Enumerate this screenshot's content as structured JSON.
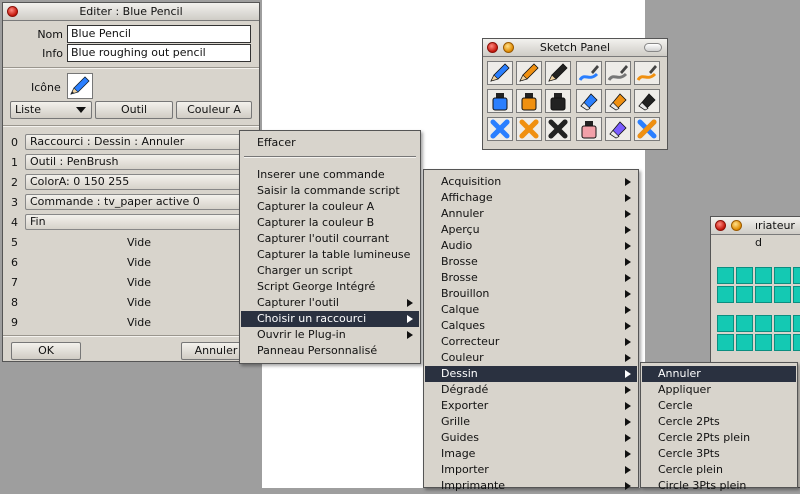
{
  "editor": {
    "title": "Editer : Blue Pencil",
    "nom_label": "Nom",
    "nom_value": "Blue Pencil",
    "info_label": "Info",
    "info_value": "Blue roughing out pencil",
    "icone_label": "Icône",
    "liste_label": "Liste",
    "outil_label": "Outil",
    "couleur_label": "Couleur A",
    "slots": [
      {
        "index": "0",
        "text": "Raccourci : Dessin : Annuler"
      },
      {
        "index": "1",
        "text": "Outil : PenBrush"
      },
      {
        "index": "2",
        "text": "ColorA: 0 150 255"
      },
      {
        "index": "3",
        "text": "Commande : tv_paper active 0"
      },
      {
        "index": "4",
        "text": "Fin"
      },
      {
        "index": "5",
        "text": "Vide"
      },
      {
        "index": "6",
        "text": "Vide"
      },
      {
        "index": "7",
        "text": "Vide"
      },
      {
        "index": "8",
        "text": "Vide"
      },
      {
        "index": "9",
        "text": "Vide"
      }
    ],
    "ok_label": "OK",
    "annuler_label": "Annuler"
  },
  "context_menu": {
    "items": [
      {
        "label": "Effacer"
      },
      {
        "label": "Inserer une commande"
      },
      {
        "label": "Saisir la commande script"
      },
      {
        "label": "Capturer la couleur A"
      },
      {
        "label": "Capturer la couleur B"
      },
      {
        "label": "Capturer l'outil courrant"
      },
      {
        "label": "Capturer la table lumineuse"
      },
      {
        "label": "Charger un script"
      },
      {
        "label": "Script George Intégré"
      },
      {
        "label": "Capturer l'outil"
      },
      {
        "label": "Choisir un raccourci"
      },
      {
        "label": "Ouvrir le Plug-in"
      },
      {
        "label": "Panneau Personnalisé"
      }
    ]
  },
  "category_menu": {
    "items": [
      "Acquisition",
      "Affichage",
      "Annuler",
      "Aperçu",
      "Audio",
      "Brosse",
      "Brosse",
      "Brouillon",
      "Calque",
      "Calques",
      "Correcteur",
      "Couleur",
      "Dessin",
      "Dégradé",
      "Exporter",
      "Grille",
      "Guides",
      "Image",
      "Importer",
      "Imprimante"
    ],
    "selected": "Dessin"
  },
  "dessin_menu": {
    "items": [
      "Annuler",
      "Appliquer",
      "Cercle",
      "Cercle 2Pts",
      "Cercle 2Pts plein",
      "Cercle 3Pts",
      "Cercle plein",
      "Circle 3Pts plein"
    ],
    "selected": "Annuler"
  },
  "sketch_panel": {
    "title": "Sketch Panel",
    "tools": [
      "blue-pencil-icon",
      "orange-pencil-icon",
      "black-pencil-icon",
      "blue-brush-icon",
      "gray-brush-icon",
      "orange-brush-icon",
      "blue-ink-icon",
      "orange-ink-icon",
      "black-ink-icon",
      "blue-marker-icon",
      "orange-marker-icon",
      "black-marker-icon",
      "blue-eraser-x-icon",
      "orange-eraser-x-icon",
      "black-eraser-x-icon",
      "pink-eraser-icon",
      "purple-eraser-icon",
      "blue-orange-x-icon"
    ]
  },
  "partial_window": {
    "title_fragment": "ıriateur d"
  },
  "colors": {
    "menu_bg": "#d8d4cc",
    "selection": "#2a3140",
    "swatch": "#14c9b3"
  }
}
